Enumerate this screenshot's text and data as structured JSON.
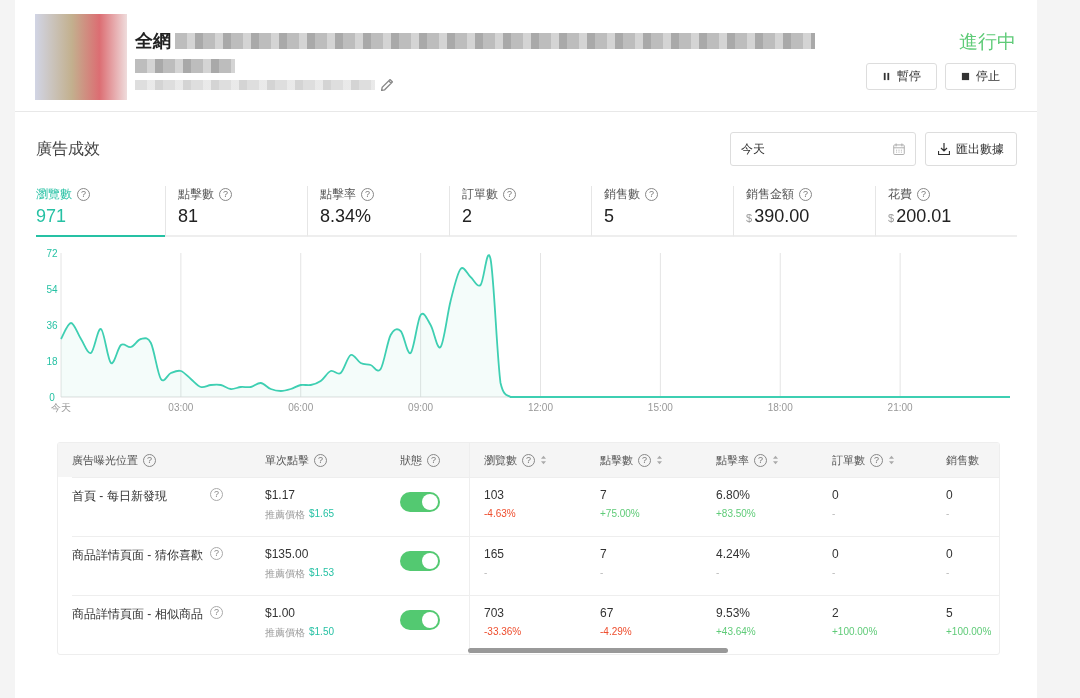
{
  "campaign": {
    "title_visible": "全網",
    "status": "進行中",
    "actions": [
      {
        "kind": "pause",
        "label": "暫停"
      },
      {
        "kind": "stop",
        "label": "停止"
      }
    ]
  },
  "performance": {
    "title": "廣告成效",
    "date_field": {
      "value": "今天"
    },
    "export_button": "匯出數據",
    "metrics": [
      {
        "label": "瀏覽數",
        "help": "?",
        "value": "971",
        "selected": true
      },
      {
        "label": "點擊數",
        "help": "?",
        "value": "81",
        "selected": false
      },
      {
        "label": "點擊率",
        "help": "?",
        "value": "8.34%",
        "selected": false
      },
      {
        "label": "訂單數",
        "help": "?",
        "value": "2",
        "selected": false
      },
      {
        "label": "銷售數",
        "help": "?",
        "value": "5",
        "selected": false
      },
      {
        "label": "銷售金額",
        "help": "?",
        "prefix": "$",
        "value": "390.00",
        "selected": false
      },
      {
        "label": "花費",
        "help": "?",
        "prefix": "$",
        "value": "200.01",
        "selected": false
      }
    ],
    "chart_data": {
      "type": "area",
      "x": [
        0,
        0.25,
        0.5,
        0.75,
        1,
        1.25,
        1.5,
        1.75,
        2,
        2.25,
        2.5,
        2.75,
        3,
        3.25,
        3.5,
        3.75,
        4,
        4.25,
        4.5,
        4.75,
        5,
        5.25,
        5.5,
        5.75,
        6,
        6.25,
        6.5,
        6.75,
        7,
        7.25,
        7.5,
        7.75,
        8,
        8.25,
        8.5,
        8.75,
        9,
        9.25,
        9.5,
        9.75,
        10,
        10.25,
        10.5,
        10.75,
        11,
        11.25,
        11.5,
        12,
        13,
        14,
        15,
        16,
        17,
        18,
        19,
        20,
        21,
        22,
        23,
        23.75
      ],
      "series": [
        {
          "color": "#3ecfb2",
          "values": [
            29,
            37,
            29,
            22,
            34,
            17,
            26,
            25,
            29,
            27,
            9,
            12,
            13,
            9,
            5,
            6,
            6,
            4,
            5,
            5,
            7,
            4,
            3,
            4,
            6,
            6,
            8,
            13,
            12,
            21,
            17,
            16,
            14,
            31,
            33,
            22,
            41,
            36,
            25,
            48,
            64,
            60,
            56,
            69,
            7,
            0,
            0,
            0,
            0,
            0,
            0,
            0,
            0,
            0,
            0,
            0,
            0,
            0,
            0,
            0
          ]
        }
      ],
      "xlim": [
        0,
        23.75
      ],
      "ylim": [
        0,
        72
      ],
      "grid": true,
      "xticks": [
        {
          "value": 0,
          "label": "今天"
        },
        {
          "value": 3,
          "label": "03:00"
        },
        {
          "value": 6,
          "label": "06:00"
        },
        {
          "value": 9,
          "label": "09:00"
        },
        {
          "value": 12,
          "label": "12:00"
        },
        {
          "value": 15,
          "label": "15:00"
        },
        {
          "value": 18,
          "label": "18:00"
        },
        {
          "value": 21,
          "label": "21:00"
        }
      ],
      "yticks": [
        0,
        18,
        36,
        54,
        72
      ]
    }
  },
  "placements": {
    "columns": [
      {
        "label": "廣告曝光位置",
        "help": "?",
        "sortable": false
      },
      {
        "label": "單次點擊",
        "help": "?",
        "sortable": false
      },
      {
        "label": "狀態",
        "help": "?",
        "sortable": false
      },
      {
        "label": "瀏覽數",
        "help": "?",
        "sortable": true
      },
      {
        "label": "點擊數",
        "help": "?",
        "sortable": true
      },
      {
        "label": "點擊率",
        "help": "?",
        "sortable": true
      },
      {
        "label": "訂單數",
        "help": "?",
        "sortable": true
      },
      {
        "label": "銷售數",
        "sortable": false
      }
    ],
    "rows": [
      {
        "placement": "首頁 - 每日新發現",
        "help": "?",
        "bid": "$1.17",
        "suggested_label": "推薦價格",
        "suggested": "$1.65",
        "on": true,
        "metrics": [
          {
            "value": "103",
            "change": "-4.63%",
            "kind": "down"
          },
          {
            "value": "7",
            "change": "+75.00%",
            "kind": "up"
          },
          {
            "value": "6.80%",
            "change": "+83.50%",
            "kind": "up"
          },
          {
            "value": "0",
            "change": "-",
            "kind": "none"
          },
          {
            "value": "0",
            "change": "-",
            "kind": "none"
          }
        ]
      },
      {
        "placement": "商品詳情頁面 - 猜你喜歡",
        "help": "?",
        "bid": "$135.00",
        "suggested_label": "推薦價格",
        "suggested": "$1.53",
        "on": true,
        "metrics": [
          {
            "value": "165",
            "change": "-",
            "kind": "none"
          },
          {
            "value": "7",
            "change": "-",
            "kind": "none"
          },
          {
            "value": "4.24%",
            "change": "-",
            "kind": "none"
          },
          {
            "value": "0",
            "change": "-",
            "kind": "none"
          },
          {
            "value": "0",
            "change": "-",
            "kind": "none"
          }
        ]
      },
      {
        "placement": "商品詳情頁面 - 相似商品",
        "help": "?",
        "bid": "$1.00",
        "suggested_label": "推薦價格",
        "suggested": "$1.50",
        "on": true,
        "metrics": [
          {
            "value": "703",
            "change": "-33.36%",
            "kind": "down"
          },
          {
            "value": "67",
            "change": "-4.29%",
            "kind": "down"
          },
          {
            "value": "9.53%",
            "change": "+43.64%",
            "kind": "up"
          },
          {
            "value": "2",
            "change": "+100.00%",
            "kind": "up"
          },
          {
            "value": "5",
            "change": "+100.00%",
            "kind": "up"
          }
        ]
      }
    ]
  }
}
